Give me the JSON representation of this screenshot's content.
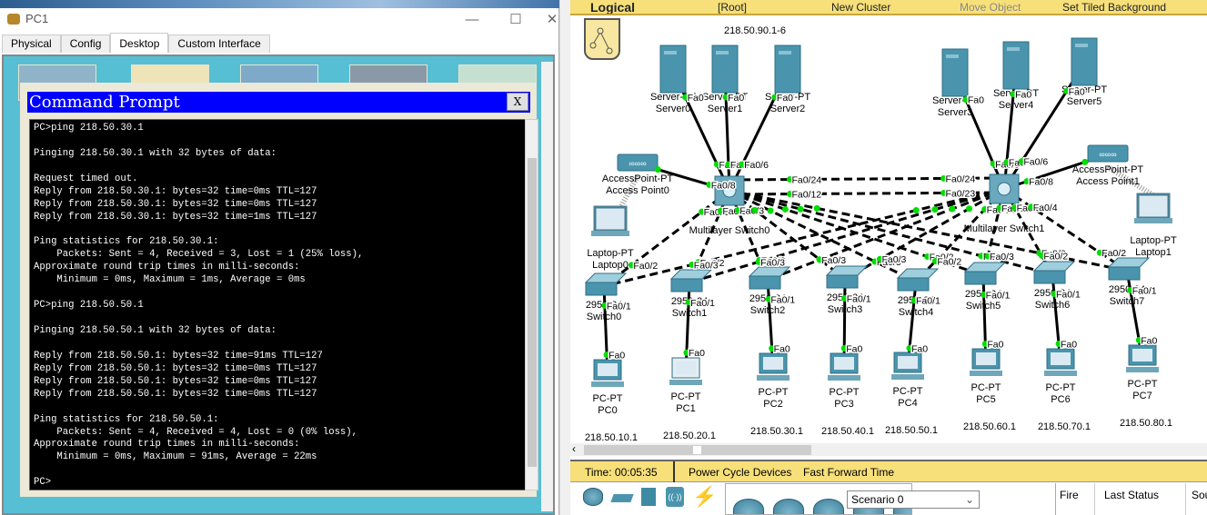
{
  "pc_window": {
    "title": "PC1",
    "controls": {
      "minimize": "—",
      "maximize": "☐",
      "close": "✕"
    },
    "tabs": [
      {
        "label": "Physical"
      },
      {
        "label": "Config"
      },
      {
        "label": "Desktop",
        "active": true
      },
      {
        "label": "Custom Interface"
      }
    ],
    "command_prompt": {
      "title": "Command Prompt",
      "close_label": "X",
      "lines": [
        "PC>ping 218.50.30.1",
        "",
        "Pinging 218.50.30.1 with 32 bytes of data:",
        "",
        "Request timed out.",
        "Reply from 218.50.30.1: bytes=32 time=0ms TTL=127",
        "Reply from 218.50.30.1: bytes=32 time=0ms TTL=127",
        "Reply from 218.50.30.1: bytes=32 time=1ms TTL=127",
        "",
        "Ping statistics for 218.50.30.1:",
        "    Packets: Sent = 4, Received = 3, Lost = 1 (25% loss),",
        "Approximate round trip times in milli-seconds:",
        "    Minimum = 0ms, Maximum = 1ms, Average = 0ms",
        "",
        "PC>ping 218.50.50.1",
        "",
        "Pinging 218.50.50.1 with 32 bytes of data:",
        "",
        "Reply from 218.50.50.1: bytes=32 time=91ms TTL=127",
        "Reply from 218.50.50.1: bytes=32 time=0ms TTL=127",
        "Reply from 218.50.50.1: bytes=32 time=0ms TTL=127",
        "Reply from 218.50.50.1: bytes=32 time=0ms TTL=127",
        "",
        "Ping statistics for 218.50.50.1:",
        "    Packets: Sent = 4, Received = 4, Lost = 0 (0% loss),",
        "Approximate round trip times in milli-seconds:",
        "    Minimum = 0ms, Maximum = 91ms, Average = 22ms",
        "",
        "PC>"
      ]
    }
  },
  "workspace": {
    "toolbar": {
      "mode": "Logical",
      "root": "[Root]",
      "new_cluster": "New Cluster",
      "move_object": "Move Object",
      "tiled_bg": "Set Tiled Background"
    },
    "note": "218.50.90.1-6",
    "colors": {
      "link": "#000000",
      "port_up": "#00dd00",
      "device": "#4a95ad",
      "toolbar": "#f7e07a"
    },
    "nodes": [
      {
        "id": "s0",
        "type": "server",
        "l1": "Server-PT",
        "l2": "Server0"
      },
      {
        "id": "s1",
        "type": "server",
        "l1": "Server-PT",
        "l2": "Server1"
      },
      {
        "id": "s2",
        "type": "server",
        "l1": "Server-PT",
        "l2": "Server2"
      },
      {
        "id": "s3",
        "type": "server",
        "l1": "Server-PT",
        "l2": "Server3"
      },
      {
        "id": "s4",
        "type": "server",
        "l1": "Server-PT",
        "l2": "Server4"
      },
      {
        "id": "s5",
        "type": "server",
        "l1": "Server-PT",
        "l2": "Server5"
      },
      {
        "id": "m0",
        "type": "mls",
        "l1": "",
        "l2": "Multilayer Switch0"
      },
      {
        "id": "m1",
        "type": "mls",
        "l1": "",
        "l2": "Multilayer Switch1"
      },
      {
        "id": "ap0",
        "type": "ap",
        "l1": "AccessPoint-PT",
        "l2": "Access Point0"
      },
      {
        "id": "ap1",
        "type": "ap",
        "l1": "AccessPoint-PT",
        "l2": "Access Point1"
      },
      {
        "id": "lp0",
        "type": "laptop",
        "l1": "Laptop-PT",
        "l2": "Laptop0"
      },
      {
        "id": "lp1",
        "type": "laptop",
        "l1": "Laptop-PT",
        "l2": "Laptop1"
      },
      {
        "id": "sw0",
        "type": "switch",
        "l1": "2950-24",
        "l2": "Switch0"
      },
      {
        "id": "sw1",
        "type": "switch",
        "l1": "2950-24",
        "l2": "Switch1"
      },
      {
        "id": "sw2",
        "type": "switch",
        "l1": "2950-24",
        "l2": "Switch2"
      },
      {
        "id": "sw3",
        "type": "switch",
        "l1": "2950-24",
        "l2": "Switch3"
      },
      {
        "id": "sw4",
        "type": "switch",
        "l1": "2950-24",
        "l2": "Switch4"
      },
      {
        "id": "sw5",
        "type": "switch",
        "l1": "2950-24",
        "l2": "Switch5"
      },
      {
        "id": "sw6",
        "type": "switch",
        "l1": "2950-24",
        "l2": "Switch6"
      },
      {
        "id": "sw7",
        "type": "switch",
        "l1": "2950-24",
        "l2": "Switch7"
      },
      {
        "id": "pc0",
        "type": "pc",
        "l1": "PC-PT",
        "l2": "PC0",
        "ip": "218.50.10.1"
      },
      {
        "id": "pc1",
        "type": "pc",
        "l1": "PC-PT",
        "l2": "PC1",
        "ip": "218.50.20.1"
      },
      {
        "id": "pc2",
        "type": "pc",
        "l1": "PC-PT",
        "l2": "PC2",
        "ip": "218.50.30.1"
      },
      {
        "id": "pc3",
        "type": "pc",
        "l1": "PC-PT",
        "l2": "PC3",
        "ip": "218.50.40.1"
      },
      {
        "id": "pc4",
        "type": "pc",
        "l1": "PC-PT",
        "l2": "PC4",
        "ip": "218.50.50.1"
      },
      {
        "id": "pc5",
        "type": "pc",
        "l1": "PC-PT",
        "l2": "PC5",
        "ip": "218.50.60.1"
      },
      {
        "id": "pc6",
        "type": "pc",
        "l1": "PC-PT",
        "l2": "PC6",
        "ip": "218.50.70.1"
      },
      {
        "id": "pc7",
        "type": "pc",
        "l1": "PC-PT",
        "l2": "PC7",
        "ip": "218.50.80.1"
      }
    ],
    "links": [
      {
        "a": "s0",
        "b": "m0",
        "pa": "Fa0",
        "pb": "Fa0/5",
        "style": "solid"
      },
      {
        "a": "s1",
        "b": "m0",
        "pa": "Fa0",
        "pb": "Fa0/7",
        "style": "solid"
      },
      {
        "a": "s2",
        "b": "m0",
        "pa": "Fa0",
        "pb": "Fa0/6",
        "style": "solid"
      },
      {
        "a": "ap0",
        "b": "m0",
        "pa": "",
        "pb": "Fa0/8",
        "style": "solid"
      },
      {
        "a": "s3",
        "b": "m1",
        "pa": "Fa0",
        "pb": "Fa0/5",
        "style": "solid"
      },
      {
        "a": "s4",
        "b": "m1",
        "pa": "Fa0",
        "pb": "Fa0/7",
        "style": "solid"
      },
      {
        "a": "s5",
        "b": "m1",
        "pa": "Fa0",
        "pb": "Fa0/6",
        "style": "solid"
      },
      {
        "a": "ap1",
        "b": "m1",
        "pa": "",
        "pb": "Fa0/8",
        "style": "solid"
      },
      {
        "a": "m0",
        "b": "m1",
        "pa": "Fa0/24",
        "pb": "Fa0/24",
        "style": "dashed",
        "off": -12
      },
      {
        "a": "m0",
        "b": "m1",
        "pa": "Fa0/12",
        "pb": "Fa0/23",
        "style": "dashed",
        "off": 4
      },
      {
        "a": "m0",
        "b": "sw0",
        "pa": "Fa0/1",
        "pb": "Fa0/2",
        "style": "dashed"
      },
      {
        "a": "m0",
        "b": "sw1",
        "pa": "Fa0/2",
        "pb": "Fa0/2",
        "style": "dashed"
      },
      {
        "a": "m0",
        "b": "sw2",
        "pa": "Fa0/3",
        "pb": "Fa0/2",
        "style": "dashed"
      },
      {
        "a": "m0",
        "b": "sw3",
        "pa": "",
        "pb": "Fa0/2",
        "style": "dashed"
      },
      {
        "a": "m0",
        "b": "sw4",
        "pa": "",
        "pb": "Fa0/3",
        "style": "dashed"
      },
      {
        "a": "m0",
        "b": "sw5",
        "pa": "",
        "pb": "Fa0/2",
        "style": "dashed"
      },
      {
        "a": "m0",
        "b": "sw6",
        "pa": "",
        "pb": "Fa0/3",
        "style": "dashed"
      },
      {
        "a": "m0",
        "b": "sw7",
        "pa": "",
        "pb": "Fa0/3",
        "style": "dashed"
      },
      {
        "a": "m1",
        "b": "sw0",
        "pa": "",
        "pb": "Fa0/3",
        "style": "dashed"
      },
      {
        "a": "m1",
        "b": "sw1",
        "pa": "",
        "pb": "Fa0/3",
        "style": "dashed"
      },
      {
        "a": "m1",
        "b": "sw2",
        "pa": "",
        "pb": "Fa0/3",
        "style": "dashed"
      },
      {
        "a": "m1",
        "b": "sw3",
        "pa": "",
        "pb": "Fa0/3",
        "style": "dashed"
      },
      {
        "a": "m1",
        "b": "sw4",
        "pa": "Fa0/12",
        "pb": "Fa0/2",
        "style": "dashed"
      },
      {
        "a": "m1",
        "b": "sw5",
        "pa": "Fa0/2",
        "pb": "Fa0/3",
        "style": "dashed"
      },
      {
        "a": "m1",
        "b": "sw6",
        "pa": "Fa0/3",
        "pb": "Fa0/2",
        "style": "dashed"
      },
      {
        "a": "m1",
        "b": "sw7",
        "pa": "Fa0/4",
        "pb": "Fa0/2",
        "style": "dashed"
      },
      {
        "a": "sw0",
        "b": "pc0",
        "pa": "Fa0/1",
        "pb": "Fa0",
        "style": "solid"
      },
      {
        "a": "sw1",
        "b": "pc1",
        "pa": "Fa0/1",
        "pb": "Fa0",
        "style": "solid"
      },
      {
        "a": "sw2",
        "b": "pc2",
        "pa": "Fa0/1",
        "pb": "Fa0",
        "style": "solid"
      },
      {
        "a": "sw3",
        "b": "pc3",
        "pa": "Fa0/1",
        "pb": "Fa0",
        "style": "solid"
      },
      {
        "a": "sw4",
        "b": "pc4",
        "pa": "Fa0/1",
        "pb": "Fa0",
        "style": "solid"
      },
      {
        "a": "sw5",
        "b": "pc5",
        "pa": "Fa0/1",
        "pb": "Fa0",
        "style": "solid"
      },
      {
        "a": "sw6",
        "b": "pc6",
        "pa": "Fa0/1",
        "pb": "Fa0",
        "style": "solid"
      },
      {
        "a": "sw7",
        "b": "pc7",
        "pa": "Fa0/1",
        "pb": "Fa0",
        "style": "solid"
      }
    ],
    "wireless": [
      {
        "a": "ap0",
        "b": "lp0"
      },
      {
        "a": "ap1",
        "b": "lp1"
      }
    ]
  },
  "statusbar": {
    "time": "Time: 00:05:35",
    "power_cycle": "Power Cycle Devices",
    "fast_forward": "Fast Forward Time"
  },
  "bottom": {
    "scenario": "Scenario 0",
    "columns": [
      "Fire",
      "Last Status",
      "Source"
    ],
    "columns_visible": [
      "Fire",
      "Last Status",
      "Sou"
    ]
  }
}
